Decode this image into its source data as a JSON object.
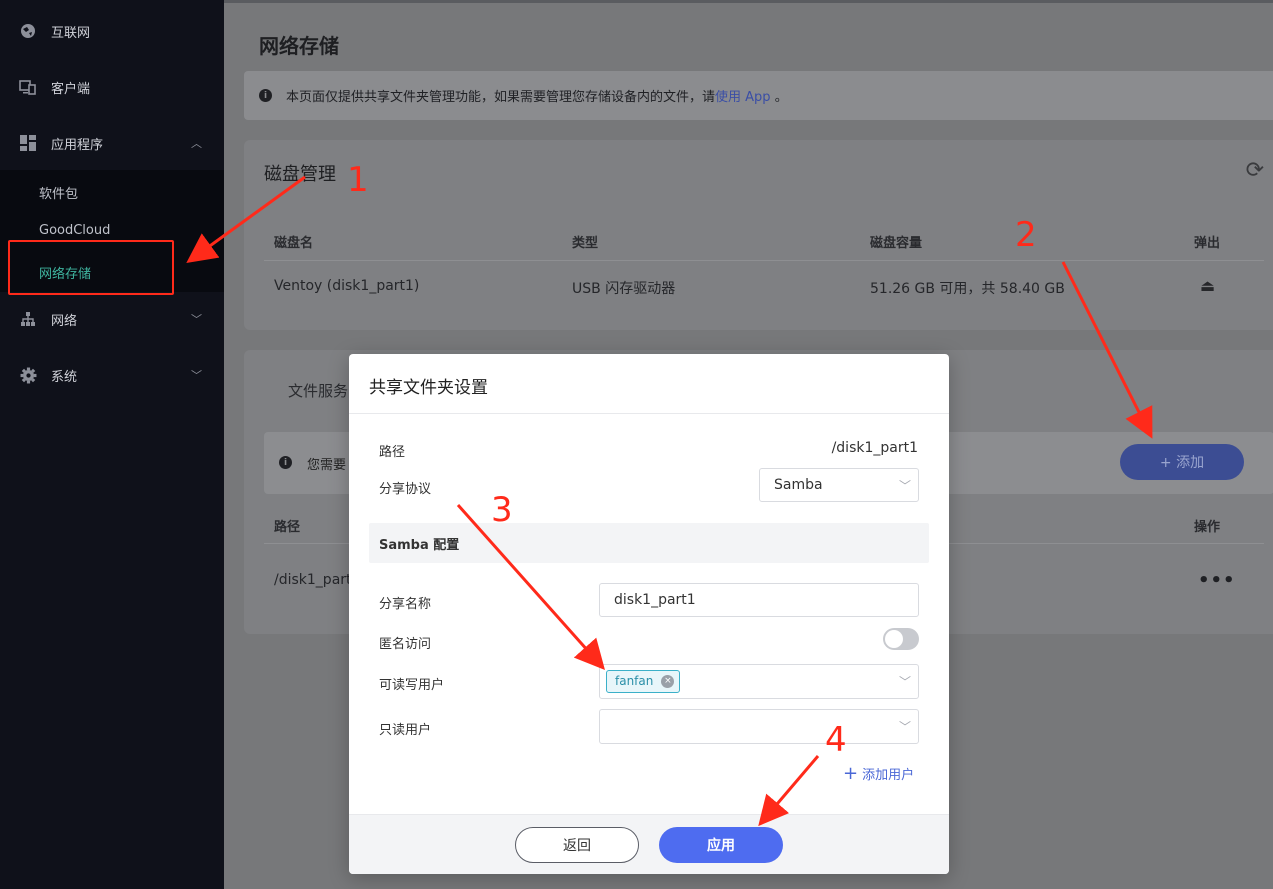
{
  "sidebar": {
    "items": [
      {
        "label": "互联网",
        "icon": "globe-icon"
      },
      {
        "label": "客户端",
        "icon": "devices-icon"
      },
      {
        "label": "应用程序",
        "icon": "apps-grid-icon"
      },
      {
        "label": "网络",
        "icon": "network-icon"
      },
      {
        "label": "系统",
        "icon": "gear-icon"
      }
    ],
    "sub_items": [
      {
        "label": "软件包"
      },
      {
        "label": "GoodCloud"
      },
      {
        "label": "网络存储"
      }
    ]
  },
  "page": {
    "title": "网络存储",
    "notice": {
      "text": "本页面仅提供共享文件夹管理功能，如果需要管理您存储设备内的文件，请",
      "link": "使用 App",
      "suffix": "。"
    }
  },
  "disk_card": {
    "title": "磁盘管理",
    "headers": [
      "磁盘名",
      "类型",
      "磁盘容量",
      "弹出"
    ],
    "row": {
      "name": "Ventoy (disk1_part1)",
      "type": "USB 闪存驱动器",
      "capacity": "51.26 GB 可用，共 58.40 GB"
    }
  },
  "share_card": {
    "tab": "文件服务",
    "note": "您需要",
    "add_button": "+ 添加",
    "headers": {
      "path": "路径",
      "action": "操作"
    },
    "row_path": "/disk1_part",
    "more": "•••"
  },
  "modal": {
    "title": "共享文件夹设置",
    "path_label": "路径",
    "path_value": "/disk1_part1",
    "protocol_label": "分享协议",
    "protocol_value": "Samba",
    "section_title": "Samba 配置",
    "share_name_label": "分享名称",
    "share_name_value": "disk1_part1",
    "anon_label": "匿名访问",
    "anon_enabled": false,
    "rw_users_label": "可读写用户",
    "rw_users": [
      "fanfan"
    ],
    "ro_users_label": "只读用户",
    "add_user": "添加用户",
    "back_button": "返回",
    "apply_button": "应用"
  },
  "annotations": {
    "numbers": [
      "1",
      "2",
      "3",
      "4"
    ],
    "color": "#ff2a1a"
  },
  "colors": {
    "sidebar_bg": "#0f111a",
    "active_green": "#3fb5a0",
    "primary_blue": "#4e6cf0",
    "annotation_red": "#ff2a1a"
  }
}
